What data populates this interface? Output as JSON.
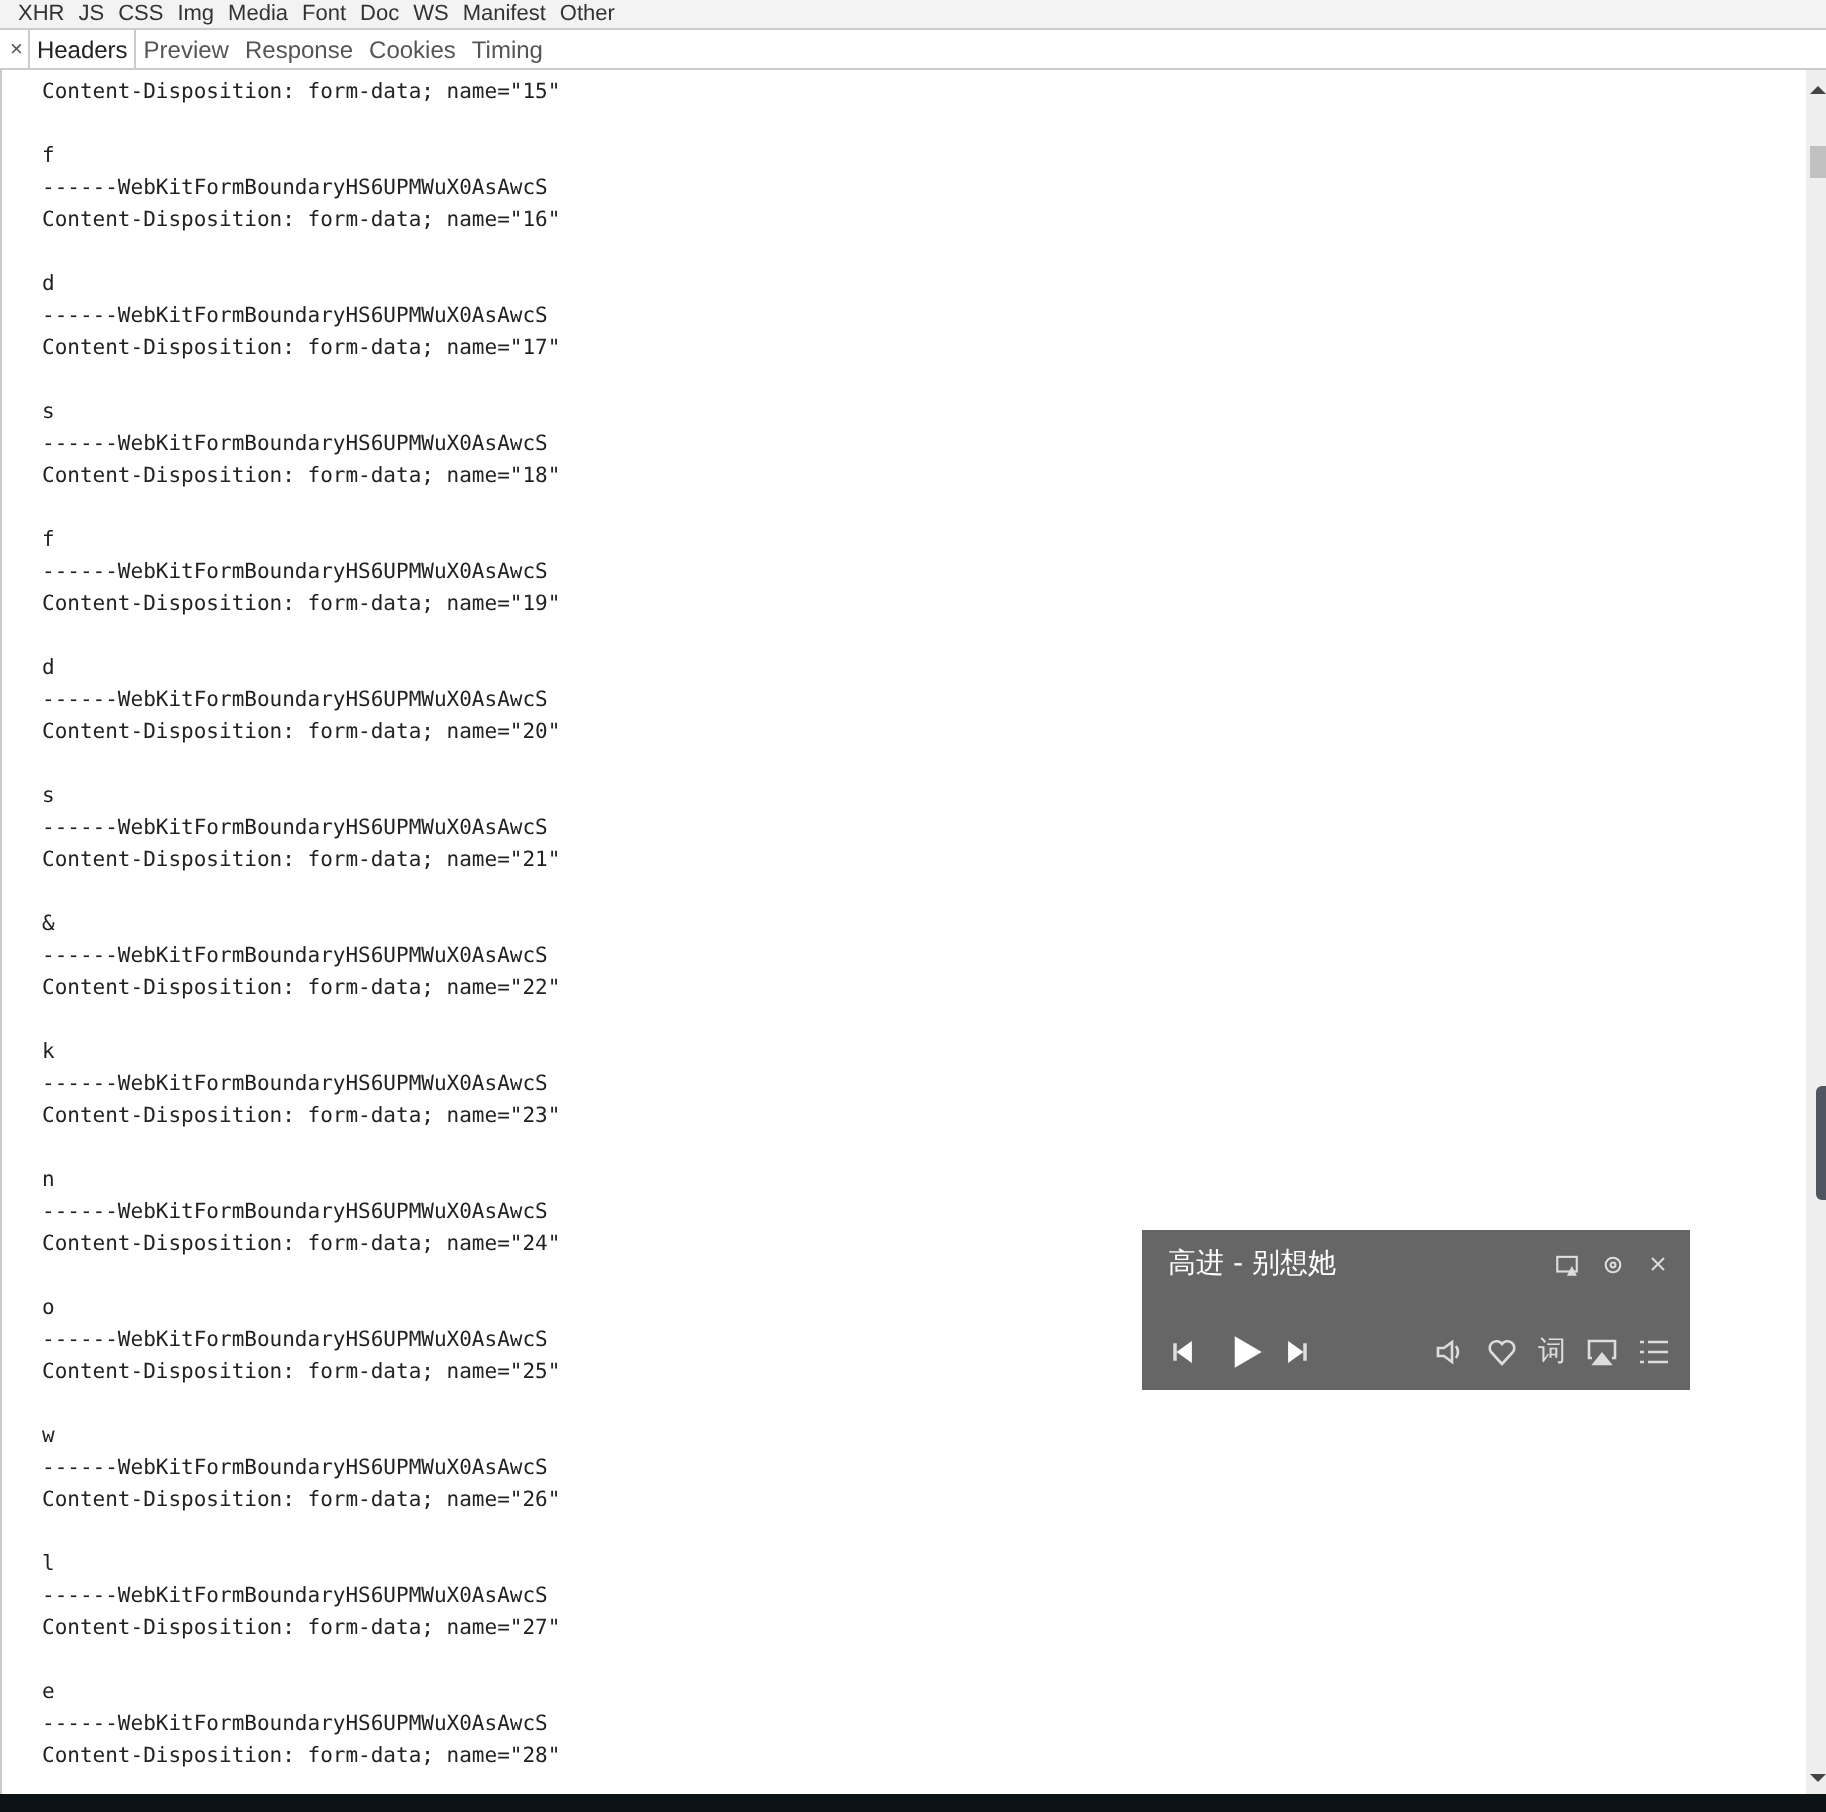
{
  "filters": [
    "XHR",
    "JS",
    "CSS",
    "Img",
    "Media",
    "Font",
    "Doc",
    "WS",
    "Manifest",
    "Other"
  ],
  "close": "×",
  "tabs": [
    {
      "label": "Headers",
      "selected": true
    },
    {
      "label": "Preview",
      "selected": false
    },
    {
      "label": "Response",
      "selected": false
    },
    {
      "label": "Cookies",
      "selected": false
    },
    {
      "label": "Timing",
      "selected": false
    }
  ],
  "first_line": "Content-Disposition: form-data; name=\"15\"",
  "parts": [
    {
      "value": "f",
      "boundary": "------WebKitFormBoundaryHS6UPMWuX0AsAwcS",
      "disposition": "Content-Disposition: form-data; name=\"16\""
    },
    {
      "value": "d",
      "boundary": "------WebKitFormBoundaryHS6UPMWuX0AsAwcS",
      "disposition": "Content-Disposition: form-data; name=\"17\""
    },
    {
      "value": "s",
      "boundary": "------WebKitFormBoundaryHS6UPMWuX0AsAwcS",
      "disposition": "Content-Disposition: form-data; name=\"18\""
    },
    {
      "value": "f",
      "boundary": "------WebKitFormBoundaryHS6UPMWuX0AsAwcS",
      "disposition": "Content-Disposition: form-data; name=\"19\""
    },
    {
      "value": "d",
      "boundary": "------WebKitFormBoundaryHS6UPMWuX0AsAwcS",
      "disposition": "Content-Disposition: form-data; name=\"20\""
    },
    {
      "value": "s",
      "boundary": "------WebKitFormBoundaryHS6UPMWuX0AsAwcS",
      "disposition": "Content-Disposition: form-data; name=\"21\""
    },
    {
      "value": "&",
      "boundary": "------WebKitFormBoundaryHS6UPMWuX0AsAwcS",
      "disposition": "Content-Disposition: form-data; name=\"22\""
    },
    {
      "value": "k",
      "boundary": "------WebKitFormBoundaryHS6UPMWuX0AsAwcS",
      "disposition": "Content-Disposition: form-data; name=\"23\""
    },
    {
      "value": "n",
      "boundary": "------WebKitFormBoundaryHS6UPMWuX0AsAwcS",
      "disposition": "Content-Disposition: form-data; name=\"24\""
    },
    {
      "value": "o",
      "boundary": "------WebKitFormBoundaryHS6UPMWuX0AsAwcS",
      "disposition": "Content-Disposition: form-data; name=\"25\""
    },
    {
      "value": "w",
      "boundary": "------WebKitFormBoundaryHS6UPMWuX0AsAwcS",
      "disposition": "Content-Disposition: form-data; name=\"26\""
    },
    {
      "value": "l",
      "boundary": "------WebKitFormBoundaryHS6UPMWuX0AsAwcS",
      "disposition": "Content-Disposition: form-data; name=\"27\""
    },
    {
      "value": "e",
      "boundary": "------WebKitFormBoundaryHS6UPMWuX0AsAwcS",
      "disposition": "Content-Disposition: form-data; name=\"28\""
    }
  ],
  "player": {
    "title": "高进 - 别想她",
    "lyrics_button": "词"
  }
}
